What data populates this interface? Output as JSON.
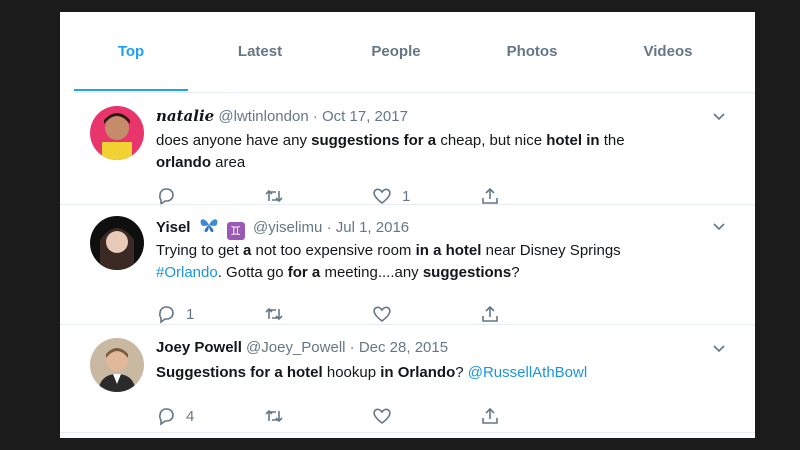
{
  "tabs": [
    {
      "label": "Top",
      "active": true
    },
    {
      "label": "Latest",
      "active": false
    },
    {
      "label": "People",
      "active": false
    },
    {
      "label": "Photos",
      "active": false
    },
    {
      "label": "Videos",
      "active": false
    }
  ],
  "tweets": [
    {
      "name": "natalie",
      "handle": "@lwtinlondon",
      "dot": "·",
      "date": "Oct 17, 2017",
      "body": [
        {
          "t": "does anyone have any ",
          "b": false
        },
        {
          "t": "suggestions for a",
          "b": true
        },
        {
          "t": " cheap, but nice ",
          "b": false
        },
        {
          "t": "hotel in",
          "b": true
        },
        {
          "t": " the ",
          "b": false
        },
        {
          "t": "orlando",
          "b": true
        },
        {
          "t": " area",
          "b": false
        }
      ],
      "reply_count": "",
      "like_count": "1"
    },
    {
      "name": "Yisel",
      "handle": "@yiselimu",
      "dot": "·",
      "date": "Jul 1, 2016",
      "badge": "♊",
      "body": [
        {
          "t": "Trying to get ",
          "b": false
        },
        {
          "t": "a",
          "b": true
        },
        {
          "t": " not too expensive room ",
          "b": false
        },
        {
          "t": "in a hotel",
          "b": true
        },
        {
          "t": " near Disney Springs ",
          "b": false
        },
        {
          "t": "#Orlando",
          "b": true,
          "link": true
        },
        {
          "t": ". Gotta go ",
          "b": false
        },
        {
          "t": "for a",
          "b": true
        },
        {
          "t": " meeting....any ",
          "b": false
        },
        {
          "t": "suggestions",
          "b": true
        },
        {
          "t": "?",
          "b": false
        }
      ],
      "reply_count": "1",
      "like_count": ""
    },
    {
      "name": "Joey Powell",
      "handle": "@Joey_Powell",
      "dot": "·",
      "date": "Dec 28, 2015",
      "body": [
        {
          "t": "Suggestions for a hotel",
          "b": true
        },
        {
          "t": " hookup ",
          "b": false
        },
        {
          "t": "in Orlando",
          "b": true
        },
        {
          "t": "? ",
          "b": false
        },
        {
          "t": "@RussellAthBowl",
          "b": false,
          "link": true
        }
      ],
      "reply_count": "4",
      "like_count": ""
    }
  ],
  "colors": {
    "accent": "#1da1f2",
    "muted": "#657786",
    "text": "#14171a"
  }
}
